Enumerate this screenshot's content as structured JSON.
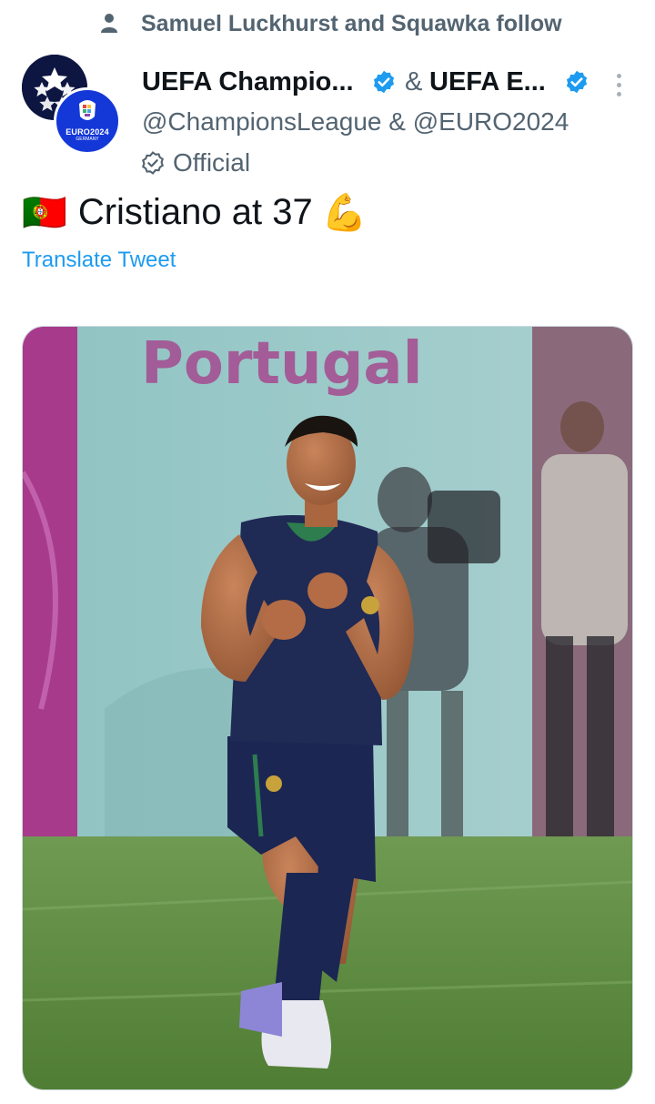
{
  "social_context": {
    "text": "Samuel Luckhurst and Squawka follow"
  },
  "author": {
    "name_1": "UEFA Champio...",
    "ampersand": "&",
    "name_2": "UEFA E...",
    "handles": "@ChampionsLeague & @EURO2024",
    "affiliation": "Official",
    "euro_badge": "EURO2024",
    "euro_badge_sub": "GERMANY"
  },
  "tweet": {
    "flag_emoji": "🇵🇹",
    "text": "Cristiano at 37",
    "emoji": "💪",
    "translate_label": "Translate Tweet"
  },
  "media": {
    "banner_text": "Portugal"
  },
  "colors": {
    "verified": "#1d9bf0",
    "link": "#1d9bf0",
    "secondary_text": "#536471",
    "ucl_navy": "#0d1541",
    "euro_blue": "#1438d8"
  },
  "icons": [
    "person-icon",
    "ucl-logo",
    "euro-logo",
    "verified-badge-icon",
    "more-options-icon",
    "official-badge-icon"
  ]
}
